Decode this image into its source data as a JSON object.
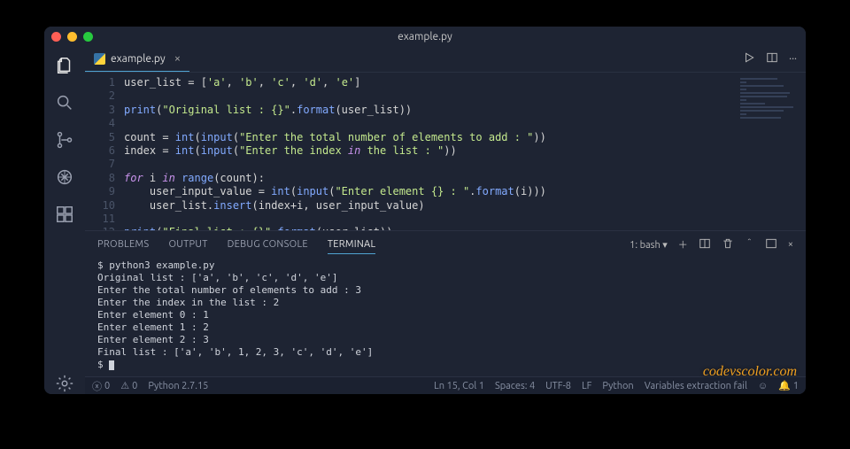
{
  "window": {
    "title": "example.py"
  },
  "tab": {
    "filename": "example.py"
  },
  "code": {
    "lines": [
      "user_list = ['a', 'b', 'c', 'd', 'e']",
      "",
      "print(\"Original list : {}\".format(user_list))",
      "",
      "count = int(input(\"Enter the total number of elements to add : \"))",
      "index = int(input(\"Enter the index in the list : \"))",
      "",
      "for i in range(count):",
      "    user_input_value = int(input(\"Enter element {} : \".format(i)))",
      "    user_list.insert(index+i, user_input_value)",
      "",
      "print(\"Final list : {}\".format(user_list))",
      ""
    ]
  },
  "panel": {
    "tabs": {
      "problems": "PROBLEMS",
      "output": "OUTPUT",
      "debug": "DEBUG CONSOLE",
      "terminal": "TERMINAL"
    },
    "term_selector": "1: bash",
    "terminal_lines": [
      "$ python3 example.py",
      "Original list : ['a', 'b', 'c', 'd', 'e']",
      "Enter the total number of elements to add : 3",
      "Enter the index in the list : 2",
      "Enter element 0 : 1",
      "Enter element 1 : 2",
      "Enter element 2 : 3",
      "Final list : ['a', 'b', 1, 2, 3, 'c', 'd', 'e']",
      "$ "
    ]
  },
  "status": {
    "errors": "0",
    "warnings": "0",
    "python_ver": "Python 2.7.15",
    "cursor": "Ln 15, Col 1",
    "spaces": "Spaces: 4",
    "encoding": "UTF-8",
    "eol": "LF",
    "lang": "Python",
    "extra": "Variables extraction fail",
    "notif": "1"
  },
  "watermark": "codevscolor.com"
}
